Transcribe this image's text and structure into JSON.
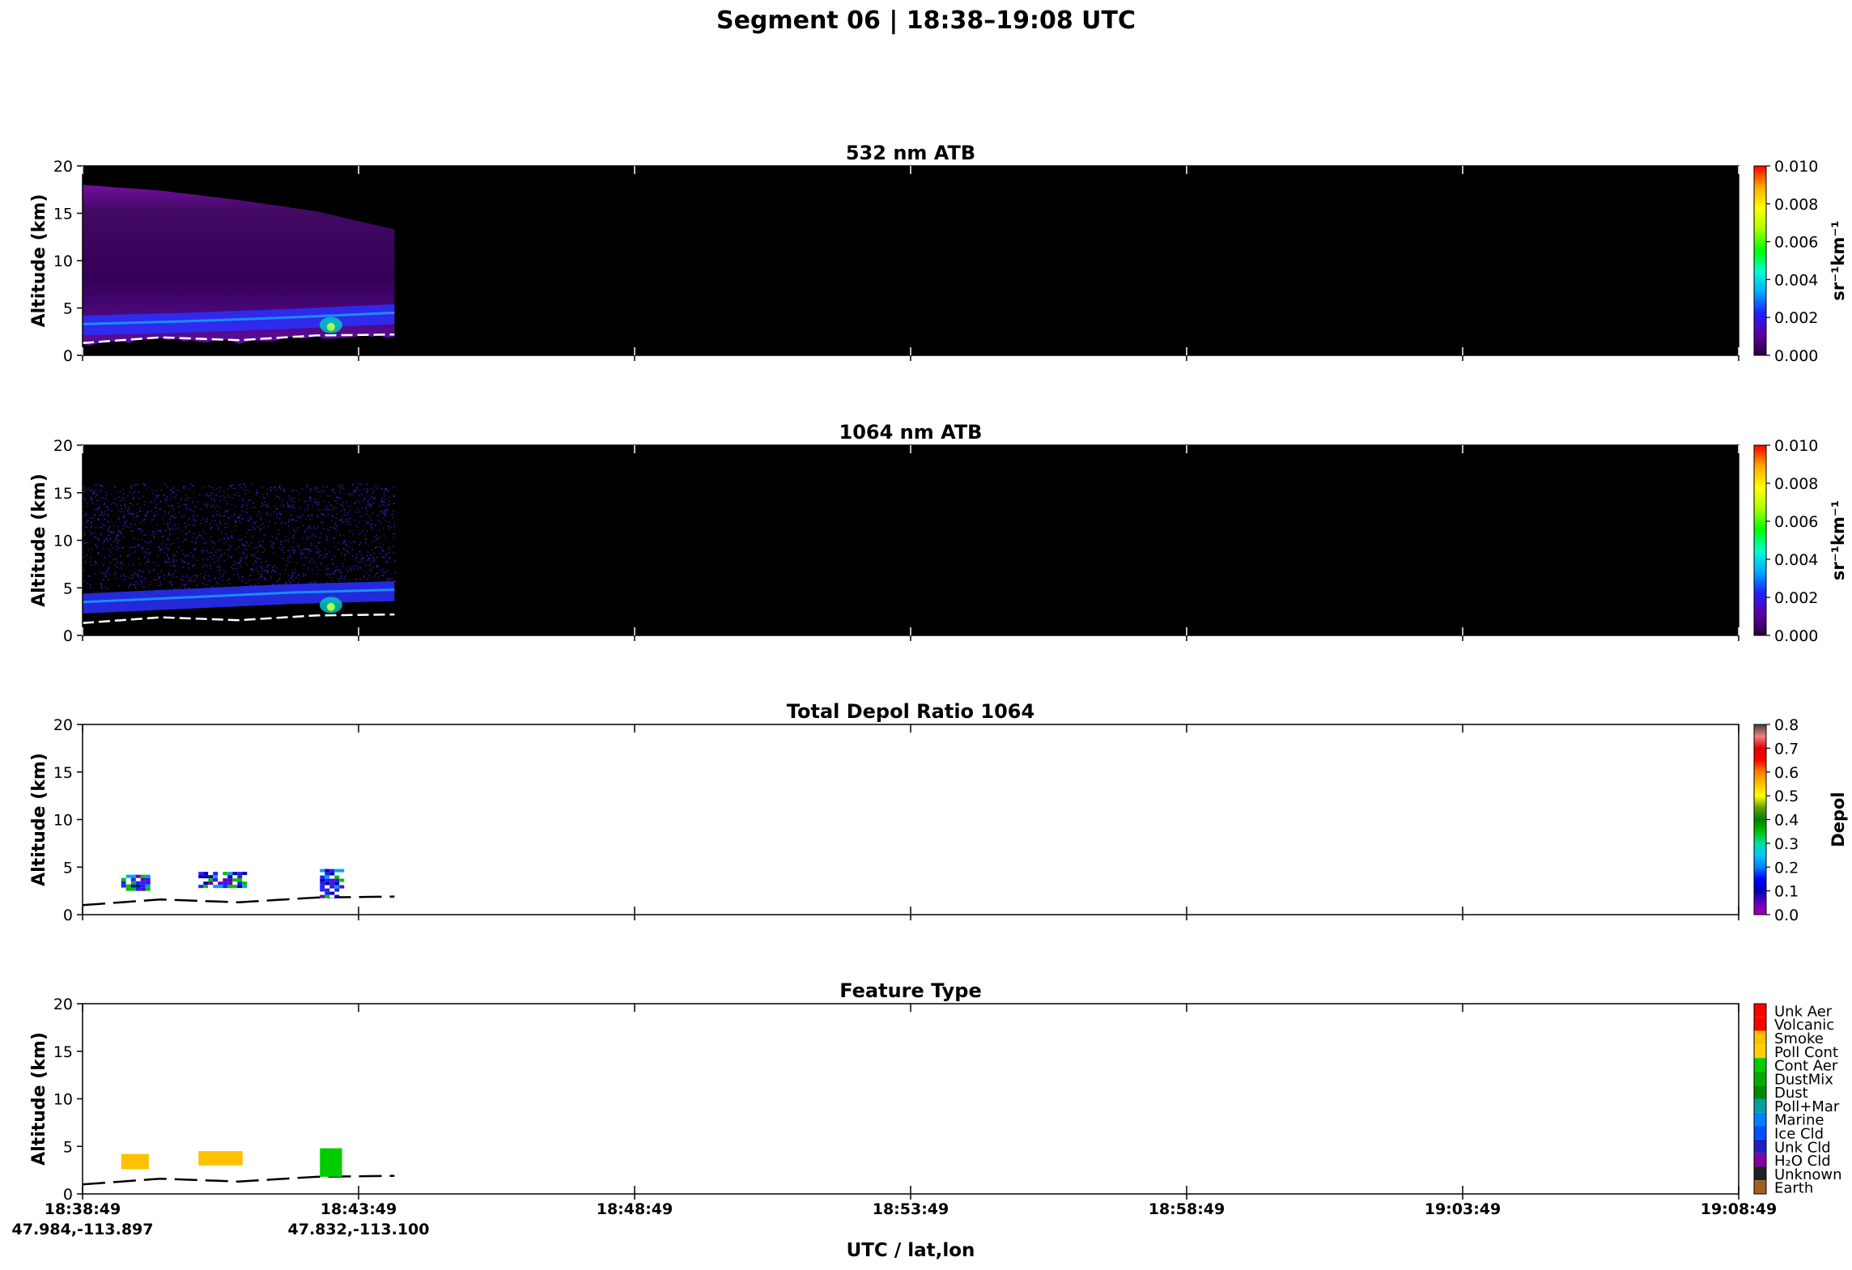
{
  "figure": {
    "title": "Segment 06  |  18:38–19:08 UTC",
    "xlabel": "UTC / lat,lon"
  },
  "chart_data": [
    {
      "type": "heatmap",
      "title": "532 nm ATB",
      "ylabel": "Altitude (km)",
      "ylim": [
        0,
        20
      ],
      "yticks": [
        0,
        5,
        10,
        15,
        20
      ],
      "xlim_minutes": [
        0,
        30
      ],
      "data_extent_minutes": [
        0,
        5.65
      ],
      "background": "#000000",
      "colorbar": {
        "label": "sr⁻¹km⁻¹",
        "range": [
          0,
          0.01
        ],
        "ticks": [
          "0.000",
          "0.002",
          "0.004",
          "0.006",
          "0.008",
          "0.010"
        ],
        "colors": [
          "#2a0040",
          "#5a00a0",
          "#2020ff",
          "#00aaff",
          "#00ffcc",
          "#00ff00",
          "#aaff00",
          "#ffff00",
          "#ffaa00",
          "#ff0000"
        ]
      },
      "layers": {
        "molecular_top_km": [
          18,
          17.4,
          16.4,
          15.2,
          13.3
        ],
        "aerosol_layer_km": [
          3.3,
          3.6,
          4.0,
          4.5
        ],
        "surface_km": [
          1.3,
          1.9,
          1.6,
          2.1,
          2.2
        ]
      }
    },
    {
      "type": "heatmap",
      "title": "1064 nm ATB",
      "ylabel": "Altitude (km)",
      "ylim": [
        0,
        20
      ],
      "yticks": [
        0,
        5,
        10,
        15,
        20
      ],
      "xlim_minutes": [
        0,
        30
      ],
      "data_extent_minutes": [
        0,
        5.65
      ],
      "background": "#000000",
      "colorbar": {
        "label": "sr⁻¹km⁻¹",
        "range": [
          0,
          0.01
        ],
        "ticks": [
          "0.000",
          "0.002",
          "0.004",
          "0.006",
          "0.008",
          "0.010"
        ],
        "colors": [
          "#2a0040",
          "#5a00a0",
          "#2020ff",
          "#00aaff",
          "#00ffcc",
          "#00ff00",
          "#aaff00",
          "#ffff00",
          "#ffaa00",
          "#ff0000"
        ]
      },
      "layers": {
        "aerosol_layer_km": [
          3.5,
          4.0,
          4.5,
          4.8
        ],
        "surface_km": [
          1.3,
          1.9,
          1.6,
          2.1,
          2.2
        ]
      }
    },
    {
      "type": "heatmap",
      "title": "Total Depol Ratio 1064",
      "ylabel": "Altitude (km)",
      "ylim": [
        0,
        20
      ],
      "yticks": [
        0,
        5,
        10,
        15,
        20
      ],
      "xlim_minutes": [
        0,
        30
      ],
      "background": "#ffffff",
      "colorbar": {
        "label": "Depol",
        "range": [
          0,
          0.8
        ],
        "ticks": [
          "0.0",
          "0.1",
          "0.2",
          "0.3",
          "0.4",
          "0.5",
          "0.6",
          "0.7",
          "0.8"
        ],
        "colors": [
          "#a000a0",
          "#6000c0",
          "#0000b0",
          "#0000ff",
          "#0080ff",
          "#00c8ff",
          "#00e0a0",
          "#00c000",
          "#008000",
          "#60a000",
          "#ffff00",
          "#ffc000",
          "#ff8000",
          "#ff0000",
          "#e00000",
          "#f08080",
          "#404040"
        ]
      },
      "features": [
        {
          "x_min": [
            0.7,
            1.2
          ],
          "alt_km": [
            2.8,
            4.2
          ]
        },
        {
          "x_min": [
            2.1,
            2.9
          ],
          "alt_km": [
            3.0,
            4.5
          ]
        },
        {
          "x_min": [
            4.3,
            4.7
          ],
          "alt_km": [
            2.0,
            4.8
          ]
        }
      ]
    },
    {
      "type": "heatmap",
      "title": "Feature Type",
      "ylabel": "Altitude (km)",
      "ylim": [
        0,
        20
      ],
      "yticks": [
        0,
        5,
        10,
        15,
        20
      ],
      "xlim_minutes": [
        0,
        30
      ],
      "background": "#ffffff",
      "xticks": [
        {
          "time": "18:38:49",
          "loc": "47.984,-113.897"
        },
        {
          "time": "18:43:49",
          "loc": "47.832,-113.100"
        },
        {
          "time": "18:48:49",
          "loc": ""
        },
        {
          "time": "18:53:49",
          "loc": ""
        },
        {
          "time": "18:58:49",
          "loc": ""
        },
        {
          "time": "19:03:49",
          "loc": ""
        },
        {
          "time": "19:08:49",
          "loc": ""
        }
      ],
      "legend_categories": [
        "Unk Aer",
        "Volcanic",
        "Smoke",
        "Poll Cont",
        "Cont Aer",
        "DustMix",
        "Dust",
        "Poll+Mar",
        "Marine",
        "Ice Cld",
        "Unk Cld",
        "H₂O Cld",
        "Unknown",
        "Earth"
      ],
      "legend_colors": [
        "#ff0000",
        "#ff0000",
        "#ffc000",
        "#ffd000",
        "#00cc00",
        "#00aa00",
        "#008800",
        "#00a0a0",
        "#0080ff",
        "#0050ff",
        "#2020c0",
        "#8000a0",
        "#202020",
        "#a06020"
      ],
      "features": [
        {
          "x_min": [
            0.7,
            1.2
          ],
          "alt_km": [
            2.6,
            4.2
          ],
          "category": "Smoke"
        },
        {
          "x_min": [
            2.1,
            2.9
          ],
          "alt_km": [
            3.0,
            4.5
          ],
          "category": "Smoke"
        },
        {
          "x_min": [
            4.3,
            4.7
          ],
          "alt_km": [
            1.8,
            4.8
          ],
          "category": "Cont Aer"
        }
      ]
    }
  ]
}
